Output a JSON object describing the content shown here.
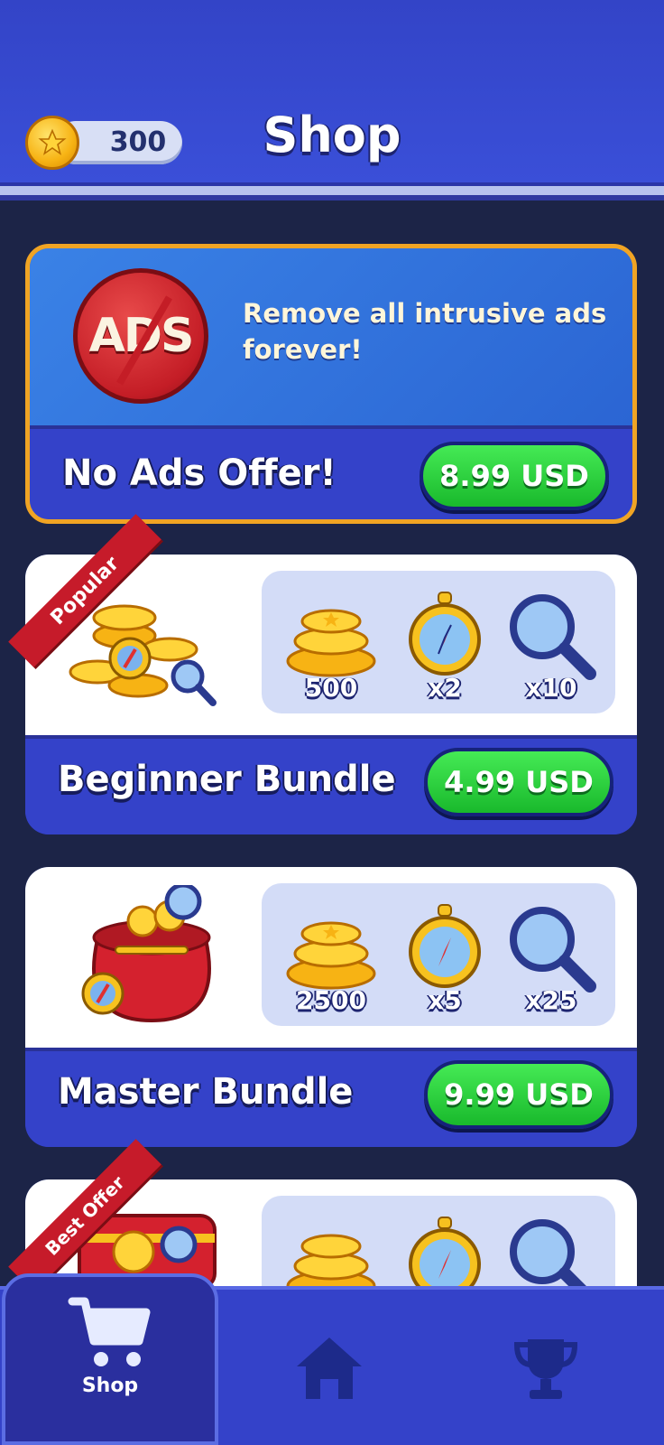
{
  "header": {
    "coins": "300",
    "title": "Shop"
  },
  "no_ads": {
    "description": "Remove all intrusive ads forever!",
    "badge_text": "ADS",
    "name": "No Ads Offer!",
    "price": "8.99 USD"
  },
  "bundles": [
    {
      "ribbon": "Popular",
      "name": "Beginner Bundle",
      "price": "4.99 USD",
      "items": [
        {
          "icon": "coin-stack-icon",
          "label": "500"
        },
        {
          "icon": "compass-icon",
          "label": "x2"
        },
        {
          "icon": "magnifier-icon",
          "label": "x10"
        }
      ]
    },
    {
      "ribbon": "",
      "name": "Master Bundle",
      "price": "9.99 USD",
      "items": [
        {
          "icon": "coin-stack-icon",
          "label": "2500"
        },
        {
          "icon": "compass-icon",
          "label": "x5"
        },
        {
          "icon": "magnifier-icon",
          "label": "x25"
        }
      ]
    },
    {
      "ribbon": "Best Offer",
      "name": "",
      "price": "",
      "items": [
        {
          "icon": "coin-stack-icon",
          "label": ""
        },
        {
          "icon": "compass-icon",
          "label": ""
        },
        {
          "icon": "magnifier-icon",
          "label": ""
        }
      ]
    }
  ],
  "nav": {
    "active": "Shop",
    "items": [
      {
        "icon": "cart-icon",
        "label": "Shop"
      },
      {
        "icon": "home-icon",
        "label": ""
      },
      {
        "icon": "trophy-icon",
        "label": ""
      }
    ]
  },
  "colors": {
    "accent_green": "#19b92c",
    "primary_blue": "#3442c9",
    "ribbon_red": "#c61b2a",
    "border_orange": "#f0a424"
  }
}
